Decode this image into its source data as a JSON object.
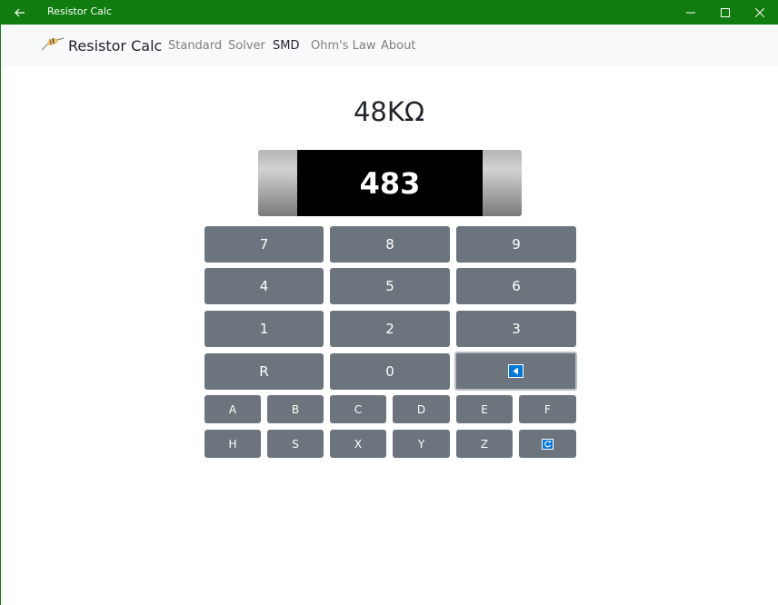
{
  "window": {
    "title": "Resistor Calc"
  },
  "navbar": {
    "brand": "Resistor Calc",
    "links": [
      "Standard",
      "Solver",
      "SMD",
      "Ohm's Law",
      "About"
    ],
    "active": "SMD"
  },
  "resistance_display": "48KΩ",
  "smd_code": "483",
  "keypad": {
    "digits": [
      "7",
      "8",
      "9",
      "4",
      "5",
      "6",
      "1",
      "2",
      "3",
      "R",
      "0"
    ],
    "backspace_icon": "backspace-icon",
    "letters": [
      "A",
      "B",
      "C",
      "D",
      "E",
      "F",
      "H",
      "S",
      "X",
      "Y",
      "Z"
    ],
    "refresh_icon": "refresh-icon"
  },
  "colors": {
    "titlebar": "#107c10",
    "key": "#6c757d",
    "icon_blue": "#0078d7"
  }
}
